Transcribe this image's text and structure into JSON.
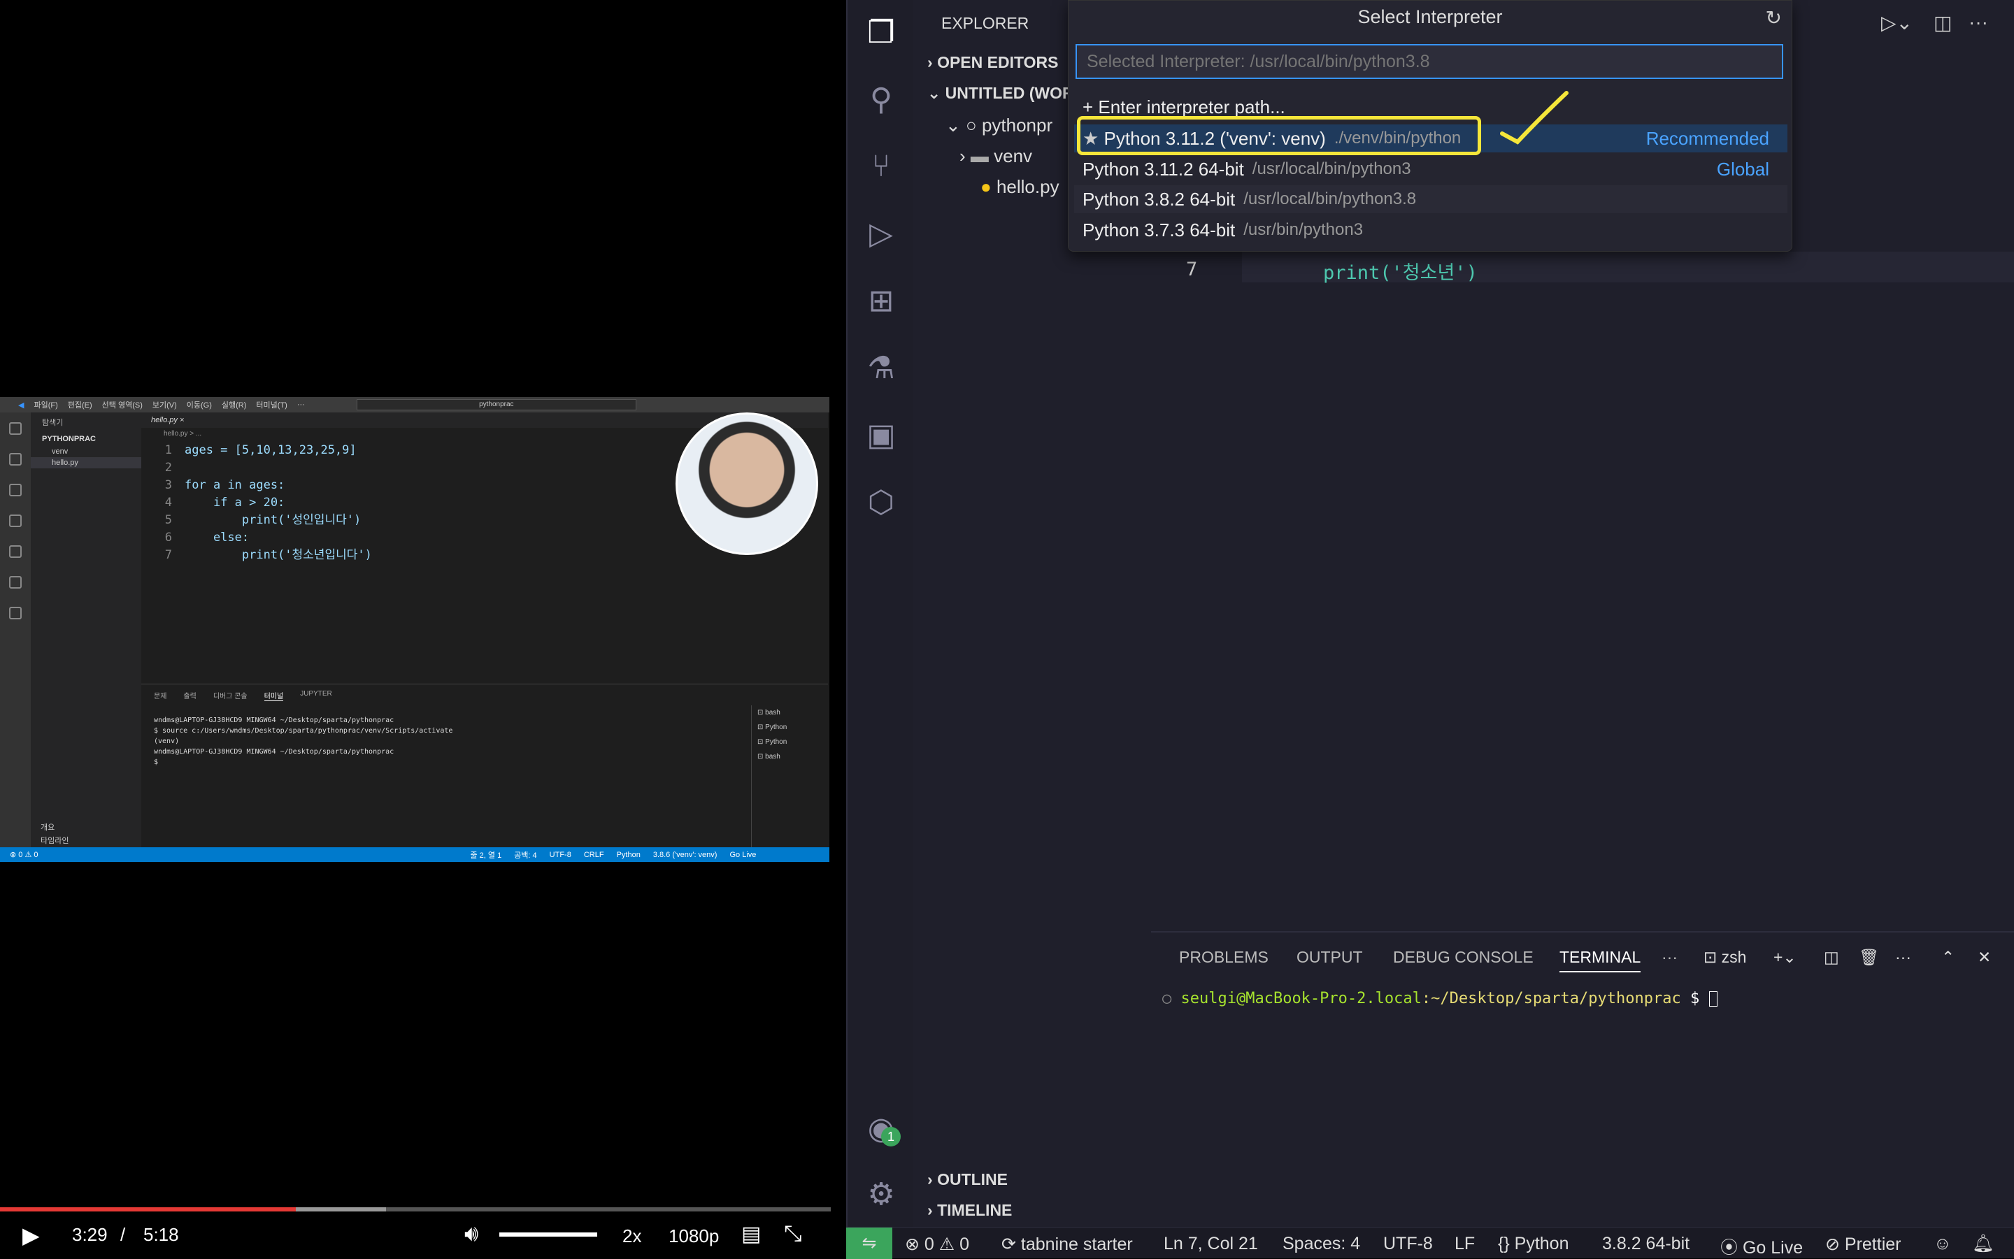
{
  "video": {
    "mini_vscode": {
      "menu": [
        "파일(F)",
        "편집(E)",
        "선택 영역(S)",
        "보기(V)",
        "이동(G)",
        "실행(R)",
        "터미널(T)",
        "···"
      ],
      "search": "pythonprac",
      "sidebar_title": "탐색기",
      "folder": "PYTHONPRAC",
      "items": [
        "venv",
        "hello.py"
      ],
      "bottom_items": [
        "개요",
        "타임라인"
      ],
      "tab": "hello.py",
      "breadcrumb": "hello.py > ...",
      "code": [
        {
          "n": "1",
          "t": "ages = [5,10,13,23,25,9]"
        },
        {
          "n": "2",
          "t": ""
        },
        {
          "n": "3",
          "t": "for a in ages:"
        },
        {
          "n": "4",
          "t": "    if a > 20:"
        },
        {
          "n": "5",
          "t": "        print('성인입니다')"
        },
        {
          "n": "6",
          "t": "    else:"
        },
        {
          "n": "7",
          "t": "        print('청소년입니다')"
        }
      ],
      "panel_tabs": [
        "문제",
        "출력",
        "디버그 콘솔",
        "터미널",
        "JUPYTER"
      ],
      "terminal_lines": [
        "wndms@LAPTOP-GJ38HCD9 MINGW64 ~/Desktop/sparta/pythonprac",
        "$ source c:/Users/wndms/Desktop/sparta/pythonprac/venv/Scripts/activate",
        "(venv)",
        "wndms@LAPTOP-GJ38HCD9 MINGW64 ~/Desktop/sparta/pythonprac",
        "$"
      ],
      "term_list": [
        "bash",
        "Python",
        "Python",
        "bash"
      ],
      "status_left": "⊗ 0 ⚠ 0",
      "status_right": [
        "줄 2, 열 1",
        "공백: 4",
        "UTF-8",
        "CRLF",
        "Python",
        "3.8.6 ('venv': venv)",
        "Go Live"
      ]
    },
    "player": {
      "current": "3:29",
      "sep": "/",
      "duration": "5:18",
      "speed": "2x",
      "quality": "1080p",
      "played_fraction": 0.356,
      "buffered_fraction": 0.465,
      "volume_fraction": 1.0
    }
  },
  "vscode": {
    "sidebar": {
      "title": "EXPLORER",
      "open_editors": "OPEN EDITORS",
      "workspace": "UNTITLED (WOR",
      "project": "pythonpr",
      "venv": "venv",
      "file": "hello.py",
      "outline": "OUTLINE",
      "timeline": "TIMELINE"
    },
    "accounts_badge": "1",
    "editor": {
      "line_no": "7",
      "code_line": "print('청소년')"
    },
    "panel": {
      "tabs": [
        "PROBLEMS",
        "OUTPUT",
        "DEBUG CONSOLE",
        "TERMINAL",
        "···"
      ],
      "active_tab": "TERMINAL",
      "shell": "zsh",
      "prompt_user": "seulgi@MacBook-Pro-2.local",
      "prompt_path": ":~/Desktop/sparta/pythonprac",
      "prompt_end": " $ "
    },
    "status": {
      "errors": "0",
      "warnings": "0",
      "tabnine": "tabnine starter",
      "position": "Ln 7, Col 21",
      "spaces": "Spaces: 4",
      "encoding": "UTF-8",
      "eol": "LF",
      "language": "Python",
      "interpreter": "3.8.2 64-bit",
      "golive": "Go Live",
      "prettier": "Prettier"
    },
    "quick_pick": {
      "title": "Select Interpreter",
      "input_placeholder": "Selected Interpreter: /usr/local/bin/python3.8",
      "enter_path": "Enter interpreter path...",
      "options": [
        {
          "label": "Python 3.11.2 ('venv': venv)",
          "path": "./venv/bin/python",
          "tag": "Recommended"
        },
        {
          "label": "Python 3.11.2 64-bit",
          "path": "/usr/local/bin/python3",
          "tag": "Global"
        },
        {
          "label": "Python 3.8.2 64-bit",
          "path": "/usr/local/bin/python3.8",
          "tag": ""
        },
        {
          "label": "Python 3.7.3 64-bit",
          "path": "/usr/bin/python3",
          "tag": ""
        }
      ],
      "highlight_color": "#f5e63a"
    }
  }
}
